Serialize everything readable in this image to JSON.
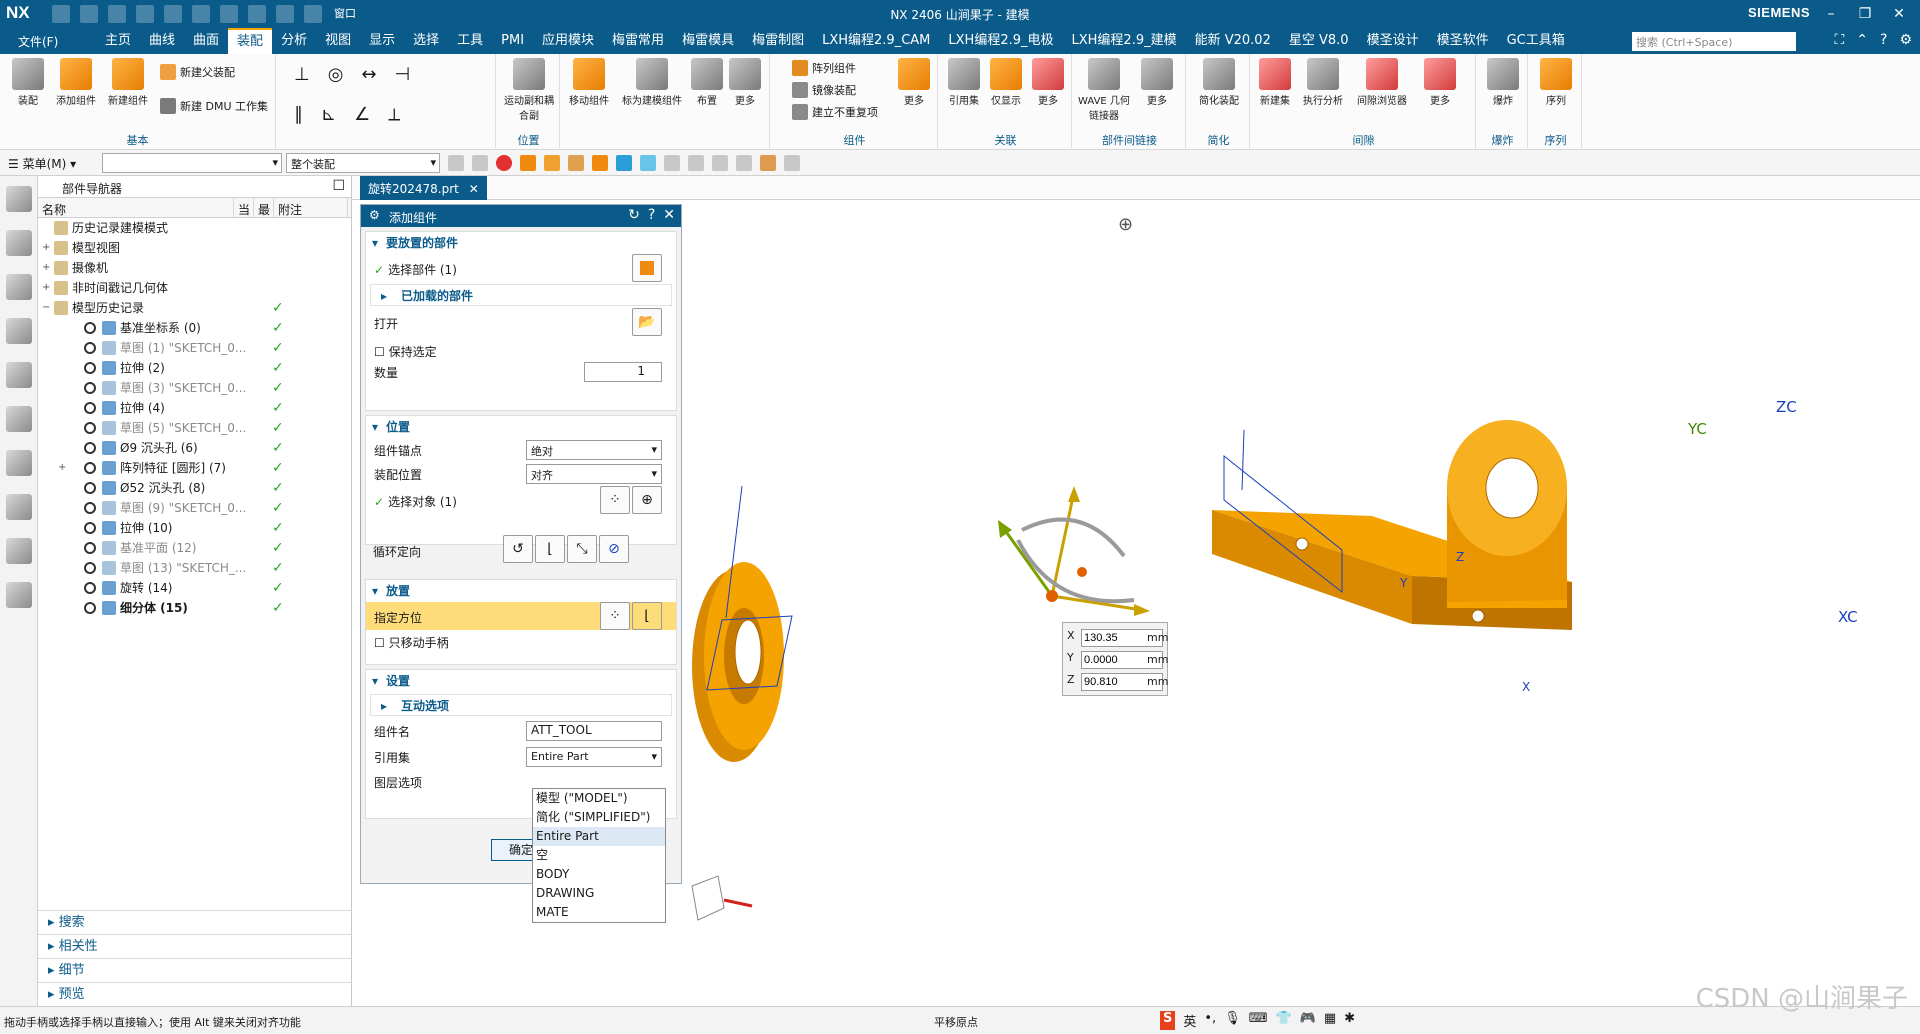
{
  "titlebar": {
    "logo": "NX",
    "title": "NX 2406 山涧果子 - 建模",
    "window_menu": "窗口",
    "brand": "SIEMENS"
  },
  "menubar": {
    "file": "文件(F)",
    "tabs": [
      "主页",
      "曲线",
      "曲面",
      "装配",
      "分析",
      "视图",
      "显示",
      "选择",
      "工具",
      "PMI",
      "应用模块",
      "梅雷常用",
      "梅雷模具",
      "梅雷制图",
      "LXH编程2.9_CAM",
      "LXH编程2.9_电极",
      "LXH编程2.9_建模",
      "能新 V20.02",
      "星空 V8.0",
      "模圣设计",
      "模圣软件",
      "GC工具箱"
    ],
    "active_tab": "装配",
    "search_placeholder": "搜索 (Ctrl+Space)"
  },
  "ribbon": {
    "groups": {
      "basic": "基本",
      "position": "位置",
      "component": "组件",
      "relation": "关联",
      "interpart": "部件间链接",
      "simplify": "简化",
      "interference": "间隙",
      "explode": "爆炸",
      "sequence": "序列"
    },
    "buttons": {
      "assembly": "装配",
      "add_component": "添加组件",
      "new_component": "新建组件",
      "new_parent": "新建父装配",
      "new_dmu": "新建 DMU 工作集",
      "motion_pair": "运动副和耦合副",
      "move_component": "移动组件",
      "constrain_component": "标为建模组件",
      "layout": "布置",
      "more1": "更多",
      "array_component": "阵列组件",
      "mirror_assembly": "镜像装配",
      "create_nonrepeat": "建立不重复项",
      "more2": "更多",
      "ref_set": "引用集",
      "show_only": "仅显示",
      "more3": "更多",
      "wave": "WAVE 几何链接器",
      "more4": "更多",
      "simplify_asm": "简化装配",
      "new_set": "新建集",
      "run_analysis": "执行分析",
      "clearance_browser": "间隙浏览器",
      "more5": "更多",
      "explode": "爆炸",
      "sequence": "序列"
    }
  },
  "toolbar2": {
    "menu": "菜单(M)",
    "filter_combo": "",
    "scope_combo": "整个装配"
  },
  "navigator": {
    "title": "部件导航器",
    "columns": [
      "名称",
      "当",
      "最",
      "附注"
    ],
    "rows": [
      {
        "label": "历史记录建模模式",
        "level": 0,
        "exp": "",
        "check": false,
        "dim": false,
        "bold": false
      },
      {
        "label": "模型视图",
        "level": 0,
        "exp": "+",
        "check": false,
        "dim": false,
        "bold": false
      },
      {
        "label": "摄像机",
        "level": 0,
        "exp": "+",
        "check": false,
        "dim": false,
        "bold": false
      },
      {
        "label": "非时间戳记几何体",
        "level": 0,
        "exp": "+",
        "check": false,
        "dim": false,
        "bold": false
      },
      {
        "label": "模型历史记录",
        "level": 0,
        "exp": "−",
        "check": true,
        "dim": false,
        "bold": false
      },
      {
        "label": "基准坐标系 (0)",
        "level": 1,
        "exp": "",
        "check": true,
        "dim": false,
        "bold": false
      },
      {
        "label": "草图 (1) \"SKETCH_0...",
        "level": 1,
        "exp": "",
        "check": true,
        "dim": true,
        "bold": false
      },
      {
        "label": "拉伸 (2)",
        "level": 1,
        "exp": "",
        "check": true,
        "dim": false,
        "bold": false
      },
      {
        "label": "草图 (3) \"SKETCH_0...",
        "level": 1,
        "exp": "",
        "check": true,
        "dim": true,
        "bold": false
      },
      {
        "label": "拉伸 (4)",
        "level": 1,
        "exp": "",
        "check": true,
        "dim": false,
        "bold": false
      },
      {
        "label": "草图 (5) \"SKETCH_0...",
        "level": 1,
        "exp": "",
        "check": true,
        "dim": true,
        "bold": false
      },
      {
        "label": "Ø9 沉头孔 (6)",
        "level": 1,
        "exp": "",
        "check": true,
        "dim": false,
        "bold": false
      },
      {
        "label": "阵列特征 [圆形] (7)",
        "level": 1,
        "exp": "+",
        "check": true,
        "dim": false,
        "bold": false
      },
      {
        "label": "Ø52 沉头孔 (8)",
        "level": 1,
        "exp": "",
        "check": true,
        "dim": false,
        "bold": false
      },
      {
        "label": "草图 (9) \"SKETCH_0...",
        "level": 1,
        "exp": "",
        "check": true,
        "dim": true,
        "bold": false
      },
      {
        "label": "拉伸 (10)",
        "level": 1,
        "exp": "",
        "check": true,
        "dim": false,
        "bold": false
      },
      {
        "label": "基准平面 (12)",
        "level": 1,
        "exp": "",
        "check": true,
        "dim": true,
        "bold": false
      },
      {
        "label": "草图 (13) \"SKETCH_...",
        "level": 1,
        "exp": "",
        "check": true,
        "dim": true,
        "bold": false
      },
      {
        "label": "旋转 (14)",
        "level": 1,
        "exp": "",
        "check": true,
        "dim": false,
        "bold": false
      },
      {
        "label": "细分体 (15)",
        "level": 1,
        "exp": "",
        "check": true,
        "dim": false,
        "bold": true
      }
    ],
    "bottom_sections": [
      "搜索",
      "相关性",
      "细节",
      "预览"
    ]
  },
  "doc_tab": {
    "name": "旋转202478.prt"
  },
  "dialog": {
    "title": "添加组件",
    "sec_part": "要放置的部件",
    "select_part": "选择部件 (1)",
    "loaded_parts": "已加载的部件",
    "open": "打开",
    "keep_selected": "保持选定",
    "quantity_label": "数量",
    "quantity_value": "1",
    "sec_position": "位置",
    "anchor_label": "组件锚点",
    "anchor_value": "绝对",
    "asm_pos_label": "装配位置",
    "asm_pos_value": "对齐",
    "select_object": "选择对象 (1)",
    "cycle_orient": "循环定向",
    "sec_place": "放置",
    "specify_orient": "指定方位",
    "only_move_handle": "只移动手柄",
    "sec_settings": "设置",
    "interaction_options": "互动选项",
    "comp_name_label": "组件名",
    "comp_name_value": "ATT_TOOL",
    "ref_set_label": "引用集",
    "ref_set_value": "Entire Part",
    "layer_label": "图层选项",
    "ok_button": "确定"
  },
  "dropdown": {
    "options": [
      "模型 (\"MODEL\")",
      "简化 (\"SIMPLIFIED\")",
      "Entire Part",
      "空",
      "BODY",
      "DRAWING",
      "MATE"
    ],
    "selected": "Entire Part"
  },
  "viewport": {
    "axis_labels": {
      "zc": "ZC",
      "yc": "YC",
      "xc": "XC",
      "x": "X",
      "y": "Y",
      "z": "Z"
    },
    "coords": {
      "x_label": "X",
      "x_value": "130.35",
      "x_unit": "mm",
      "y_label": "Y",
      "y_value": "0.0000",
      "y_unit": "mm",
      "z_label": "Z",
      "z_value": "90.810",
      "z_unit": "mm"
    }
  },
  "statusbar": {
    "message": "拖动手柄或选择手柄以直接输入；使用 Alt 键来关闭对齐功能",
    "center": "平移原点",
    "ime": "英"
  },
  "watermark": "CSDN @山涧果子",
  "colors": {
    "accent": "#0b5b8a",
    "part_orange": "#f5a300",
    "highlight": "#fedc7a",
    "check_green": "#1faa1f"
  }
}
